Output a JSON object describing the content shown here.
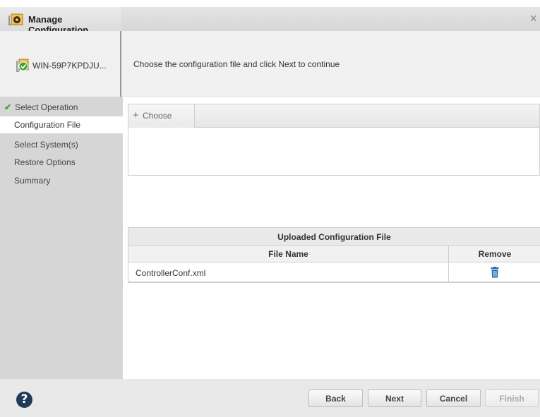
{
  "window": {
    "title": "Manage Configuration"
  },
  "header": {
    "host_name": "WIN-59P7KPDJU...",
    "instruction": "Choose the configuration file and click Next to continue"
  },
  "sidebar": {
    "steps": [
      {
        "label": "Select Operation",
        "state": "done"
      },
      {
        "label": "Configuration File",
        "state": "current"
      },
      {
        "label": "Select System(s)",
        "state": "pending"
      },
      {
        "label": "Restore Options",
        "state": "pending"
      },
      {
        "label": "Summary",
        "state": "pending"
      }
    ]
  },
  "chooser": {
    "choose_label": "Choose"
  },
  "uploaded": {
    "caption": "Uploaded Configuration File",
    "columns": [
      "File Name",
      "Remove"
    ],
    "rows": [
      {
        "file_name": "ControllerConf.xml",
        "remove_icon": "trash-icon"
      }
    ]
  },
  "footer": {
    "back_label": "Back",
    "next_label": "Next",
    "cancel_label": "Cancel",
    "finish_label": "Finish"
  },
  "colors": {
    "accent_blue": "#1f6fb8",
    "check_green": "#3aa435"
  }
}
